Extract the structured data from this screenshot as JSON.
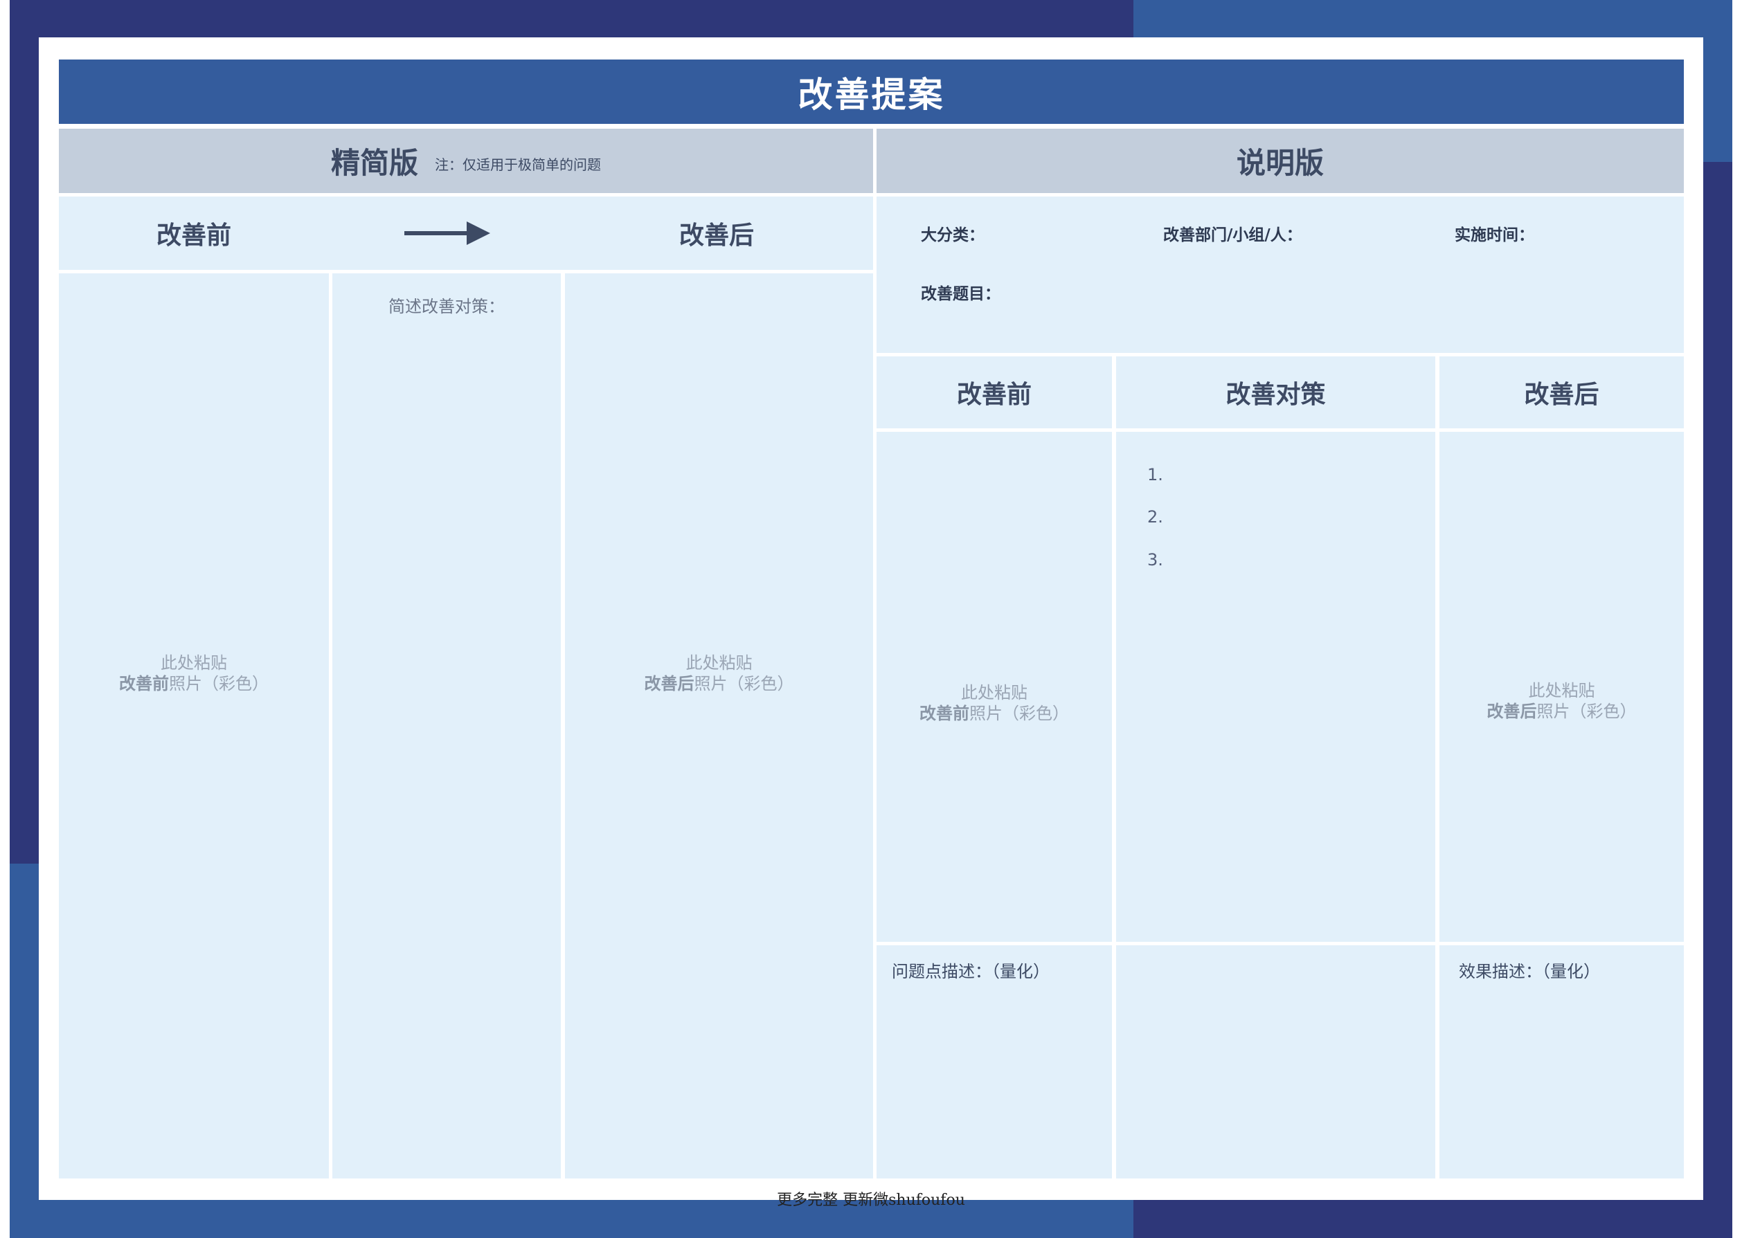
{
  "title": "改善提案",
  "simple": {
    "label": "精简版",
    "note": "注：仅适用于极简单的问题",
    "before_label": "改善前",
    "after_label": "改善后",
    "measure_prompt": "简述改善对策：",
    "before_photo": {
      "line1": "此处粘贴",
      "bold": "改善前",
      "rest": "照片（彩色）"
    },
    "after_photo": {
      "line1": "此处粘贴",
      "bold": "改善后",
      "rest": "照片（彩色）"
    }
  },
  "detail": {
    "label": "说明版",
    "category_label": "大分类：",
    "dept_label": "改善部门/小组/人：",
    "time_label": "实施时间：",
    "subject_label": "改善题目：",
    "col_before": "改善前",
    "col_measure": "改善对策",
    "col_after": "改善后",
    "measure_items": [
      "1.",
      "2.",
      "3."
    ],
    "before_photo": {
      "line1": "此处粘贴",
      "bold": "改善前",
      "rest": "照片（彩色）"
    },
    "after_photo": {
      "line1": "此处粘贴",
      "bold": "改善后",
      "rest": "照片（彩色）"
    },
    "problem_desc": "问题点描述：（量化）",
    "effect_desc": "效果描述：（量化）"
  },
  "footer": "更多完整 更新微shufoufou",
  "colors": {
    "navy": "#2e3779",
    "blue": "#345c9d",
    "panel": "#e2f0fa",
    "header_gray": "#c3cedc"
  }
}
